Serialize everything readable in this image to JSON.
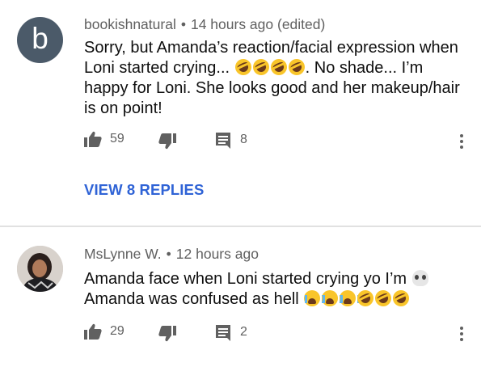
{
  "comments": [
    {
      "avatar_letter": "b",
      "author": "bookishnatural",
      "separator": "•",
      "time": "14 hours ago (edited)",
      "text_line1": "Sorry, but Amanda’s reaction/facial expression when",
      "text_line2a": "Loni started crying...",
      "text_line2b": ".  No shade... I’m",
      "text_line3": "happy for Loni. She looks good and her makeup/hair",
      "text_line4": "is on point!",
      "likes": "59",
      "replies_count": "8",
      "view_replies": "VIEW 8 REPLIES"
    },
    {
      "author": "MsLynne W.",
      "separator": "•",
      "time": "12 hours ago",
      "text_line1": "Amanda face when Loni started crying yo I’m",
      "text_line2": "Amanda was confused as hell",
      "likes": "29",
      "replies_count": "2"
    }
  ],
  "icons": {
    "like": "thumbs-up-icon",
    "dislike": "thumbs-down-icon",
    "reply": "comment-icon",
    "more": "more-vert-icon"
  },
  "colors": {
    "link": "#2f63d6",
    "meta": "#606060",
    "avatar_b": "#4b5a69"
  }
}
